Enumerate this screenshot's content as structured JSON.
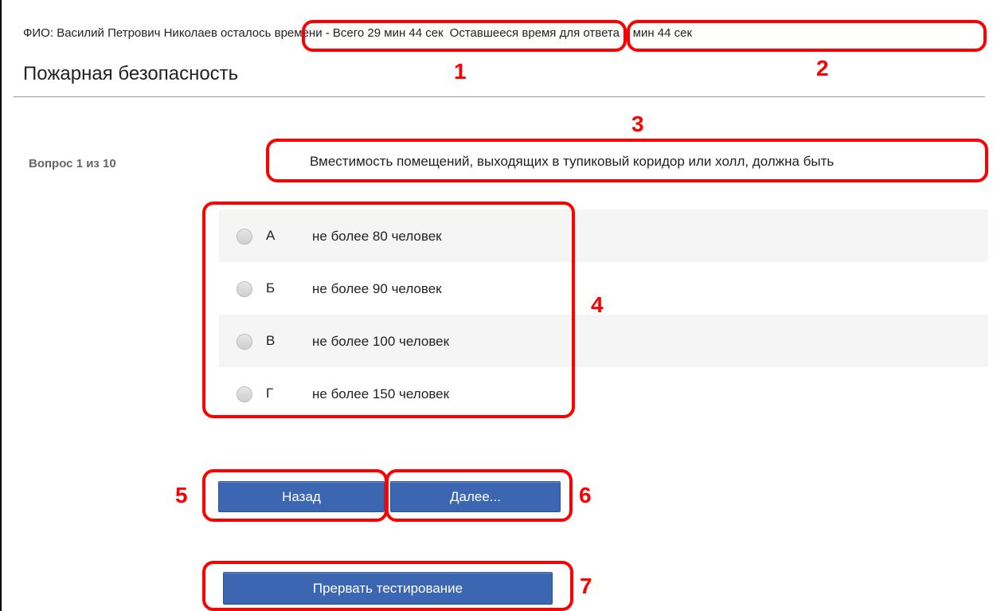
{
  "header": {
    "fio": "ФИО: Василий Петрович Николаев",
    "time_total": "осталось времени - Всего 29 мин 44 сек",
    "time_answer": "Оставшееся время для ответа 2 мин 44 сек"
  },
  "title": "Пожарная безопасность",
  "question": {
    "counter": "Вопрос 1 из 10",
    "text": "Вместимость помещений, выходящих в тупиковый коридор или холл, должна быть"
  },
  "answers": [
    {
      "letter": "А",
      "text": "не более 80 человек"
    },
    {
      "letter": "Б",
      "text": "не более 90 человек"
    },
    {
      "letter": "В",
      "text": "не более 100 человек"
    },
    {
      "letter": "Г",
      "text": "не более 150 человек"
    }
  ],
  "buttons": {
    "back": "Назад",
    "next": "Далее...",
    "abort": "Прервать тестирование"
  },
  "annotations": [
    "1",
    "2",
    "3",
    "4",
    "5",
    "6",
    "7"
  ],
  "colors": {
    "highlight": "#ff0000",
    "button": "#3c66b1",
    "row_shade": "#f5f5f5"
  }
}
